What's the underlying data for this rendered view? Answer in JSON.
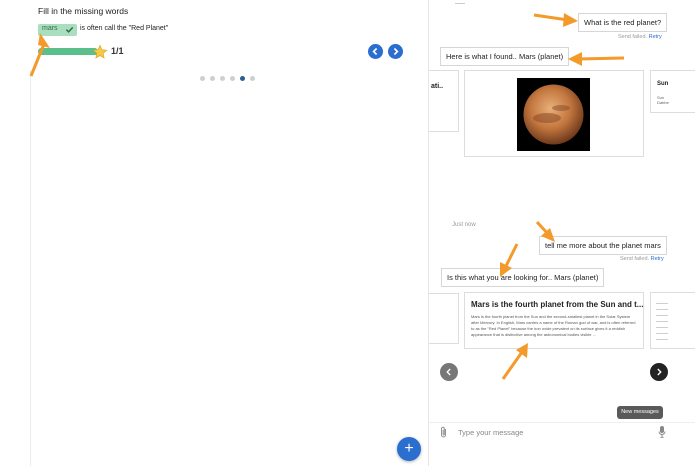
{
  "quiz": {
    "title": "Fill in the missing words",
    "answer": "mars",
    "sentence_rest": "is often call the \"Red Planet\"",
    "progress_fraction": 1.0,
    "score": "1/1",
    "pagination": {
      "total": 6,
      "active_index": 4
    },
    "add_button_label": "+"
  },
  "chat": {
    "messages": {
      "user_1": "What is the red planet?",
      "bot_1": "Here is what I found.. Mars (planet)",
      "user_2": "tell me more about the planet mars",
      "bot_2": "Is this what you are looking for.. Mars (planet)"
    },
    "send_failed": "Send failed.",
    "retry": "Retry",
    "timestamp": "Just now",
    "cards_row1": {
      "left_fragment": "ati..",
      "right_title": "Sun",
      "right_sub": "Sun Dabbe"
    },
    "card_main": {
      "title": "Mars is the fourth planet from the Sun and t...",
      "body": "Mars is the fourth planet from the Sun and the second-smallest planet in the Solar System after Mercury. In English, Mars carries a name of the Roman god of war, and is often referred to as the \"Red Planet\" because the iron oxide prevalent on its surface gives it a reddish appearance that is distinctive among the astronomical bodies visible ..."
    },
    "carousel": {
      "prev_icon": "chevron-left-icon",
      "next_icon": "chevron-right-icon"
    },
    "new_messages_label": "New messages",
    "input_placeholder": "Type your message"
  },
  "colors": {
    "primary_blue": "#2a6fd0",
    "answer_green": "#a9dfbf",
    "progress_green": "#5bbf8c",
    "annotation_orange": "#f39a2b"
  }
}
